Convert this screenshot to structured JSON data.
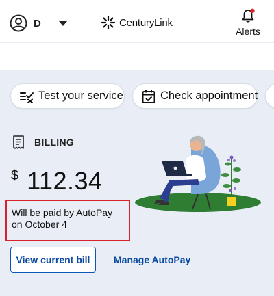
{
  "header": {
    "account_initial": "D",
    "logo_text": "CenturyLink",
    "alerts_label": "Alerts"
  },
  "actions": {
    "test_service": "Test your service",
    "check_appointment": "Check appointment"
  },
  "billing": {
    "title": "BILLING",
    "currency": "$",
    "amount": "112.34",
    "autopay_message": "Will be paid by AutoPay on October 4",
    "view_bill_label": "View current bill",
    "manage_autopay_label": "Manage AutoPay"
  },
  "colors": {
    "brand_blue": "#0b4aa0",
    "highlight_red": "#d8212a",
    "card_bg": "#e9eef6",
    "alert_dot": "#e0262c"
  }
}
